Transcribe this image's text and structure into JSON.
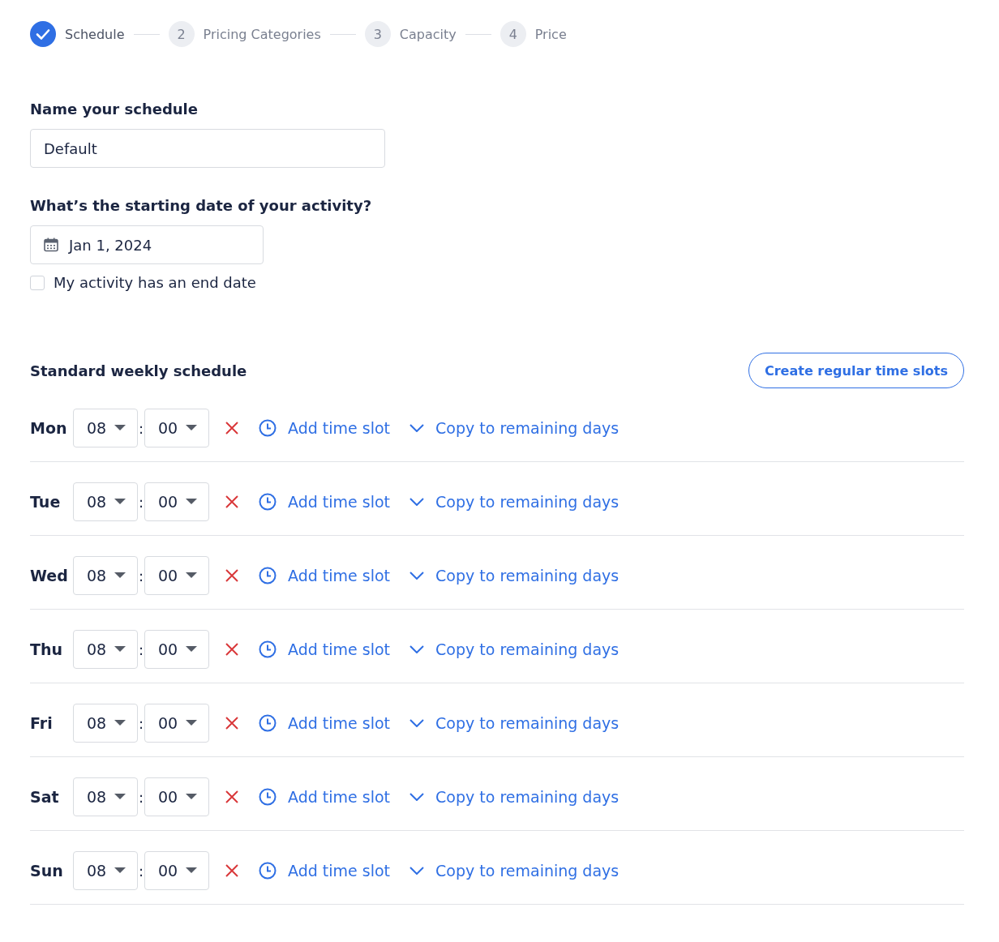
{
  "steps": [
    {
      "label": "Schedule",
      "done": true
    },
    {
      "marker": "2",
      "label": "Pricing Categories",
      "done": false
    },
    {
      "marker": "3",
      "label": "Capacity",
      "done": false
    },
    {
      "marker": "4",
      "label": "Price",
      "done": false
    }
  ],
  "name_field": {
    "label": "Name your schedule",
    "value": "Default"
  },
  "date_field": {
    "label": "What’s the starting date of your activity?",
    "value": "Jan 1, 2024"
  },
  "end_date": {
    "label": "My activity has an end date",
    "checked": false
  },
  "weekly": {
    "title": "Standard weekly schedule",
    "button": "Create regular time slots",
    "days": [
      {
        "day": "Mon",
        "hour": "08",
        "separator": ":",
        "minute": "00",
        "add": "Add time slot",
        "copy": "Copy to remaining days"
      },
      {
        "day": "Tue",
        "hour": "08",
        "separator": ":",
        "minute": "00",
        "add": "Add time slot",
        "copy": "Copy to remaining days"
      },
      {
        "day": "Wed",
        "hour": "08",
        "separator": ":",
        "minute": "00",
        "add": "Add time slot",
        "copy": "Copy to remaining days"
      },
      {
        "day": "Thu",
        "hour": "08",
        "separator": ":",
        "minute": "00",
        "add": "Add time slot",
        "copy": "Copy to remaining days"
      },
      {
        "day": "Fri",
        "hour": "08",
        "separator": ":",
        "minute": "00",
        "add": "Add time slot",
        "copy": "Copy to remaining days"
      },
      {
        "day": "Sat",
        "hour": "08",
        "separator": ":",
        "minute": "00",
        "add": "Add time slot",
        "copy": "Copy to remaining days"
      },
      {
        "day": "Sun",
        "hour": "08",
        "separator": ":",
        "minute": "00",
        "add": "Add time slot",
        "copy": "Copy to remaining days"
      }
    ]
  }
}
